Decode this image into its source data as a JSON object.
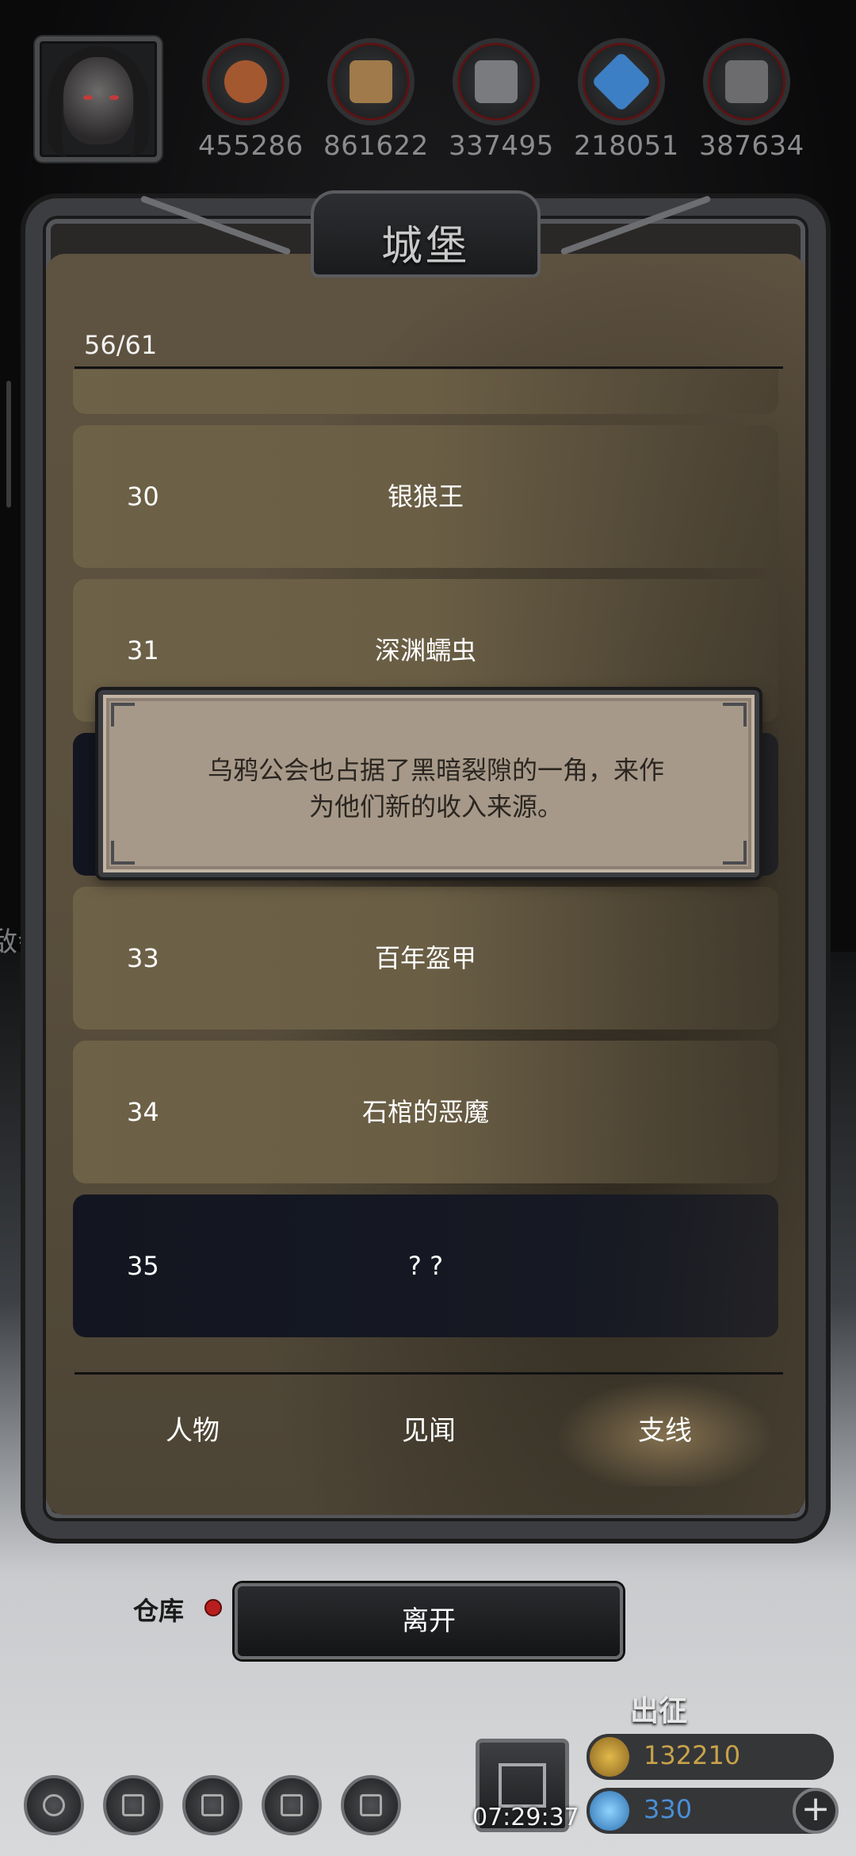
{
  "resources": [
    {
      "icon": "meat-icon",
      "value": "455286",
      "color": "#a4582f"
    },
    {
      "icon": "wood-icon",
      "value": "861622",
      "color": "#a07a4a"
    },
    {
      "icon": "iron-icon",
      "value": "337495",
      "color": "#7a7b7e"
    },
    {
      "icon": "crystal-icon",
      "value": "218051",
      "color": "#3d7fc4"
    },
    {
      "icon": "ore-icon",
      "value": "387634",
      "color": "#6c6c6e"
    }
  ],
  "panel": {
    "title": "城堡",
    "counter": "56/61",
    "rows": [
      {
        "num": "",
        "name": "",
        "locked": false
      },
      {
        "num": "30",
        "name": "银狼王",
        "locked": false
      },
      {
        "num": "31",
        "name": "深渊蠕虫",
        "locked": false
      },
      {
        "num": "",
        "name": "",
        "locked": true
      },
      {
        "num": "33",
        "name": "百年盔甲",
        "locked": false
      },
      {
        "num": "34",
        "name": "石棺的恶魔",
        "locked": false
      },
      {
        "num": "35",
        "name": "? ?",
        "locked": true
      }
    ],
    "tabs": [
      {
        "label": "人物",
        "active": false
      },
      {
        "label": "见闻",
        "active": false
      },
      {
        "label": "支线",
        "active": true
      }
    ]
  },
  "tooltip": {
    "text_line1": "乌鸦公会也占据了黑暗裂隙的一角，来作",
    "text_line2": "为他们新的收入来源。"
  },
  "leave_button": "离开",
  "warehouse_label": "仓库",
  "background_sign": "敌会",
  "bottom_bar": {
    "expedition_label": "出征",
    "timer": "07:29:37",
    "gold_value": "132210",
    "gem_value": "330",
    "plus": "+"
  }
}
